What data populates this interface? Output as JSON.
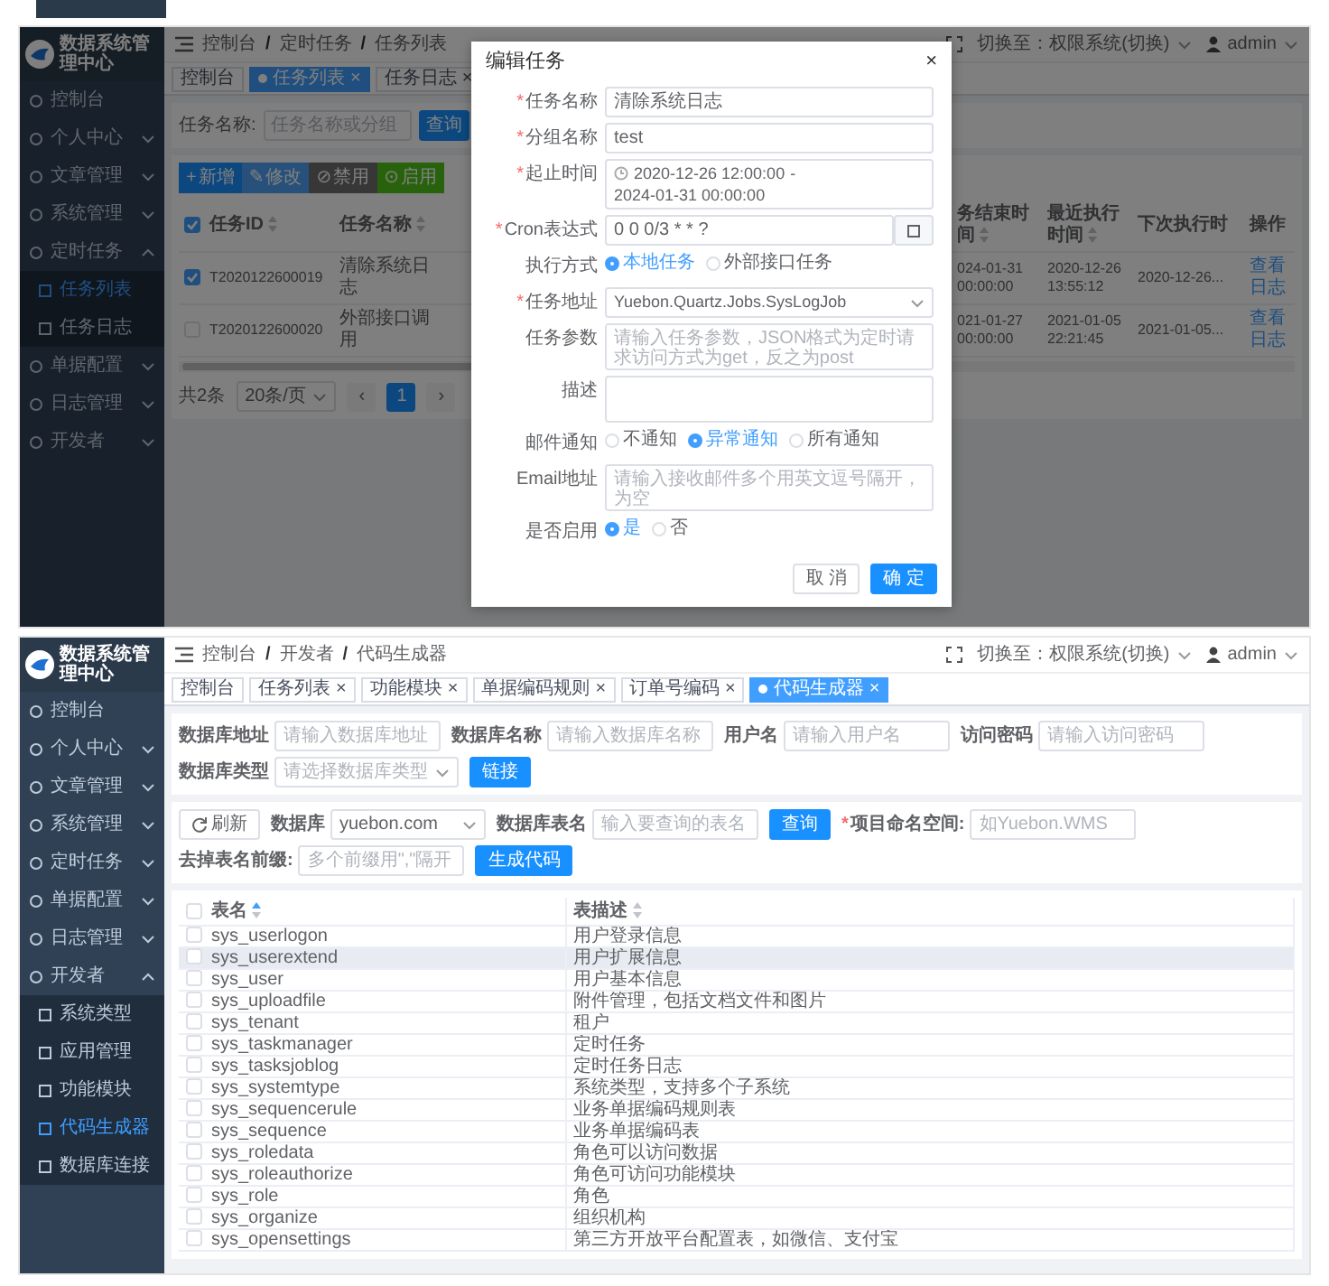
{
  "task_screen": {
    "sidebar": {
      "title": "数据系统管理中心",
      "items": [
        {
          "label": "控制台"
        },
        {
          "label": "个人中心",
          "expanded": false
        },
        {
          "label": "文章管理",
          "expanded": false
        },
        {
          "label": "系统管理",
          "expanded": false
        },
        {
          "label": "定时任务",
          "expanded": true,
          "children": [
            {
              "label": "任务列表",
              "selected": true
            },
            {
              "label": "任务日志",
              "selected": false
            }
          ]
        },
        {
          "label": "单据配置",
          "expanded": false
        },
        {
          "label": "日志管理",
          "expanded": false
        },
        {
          "label": "开发者",
          "expanded": false
        }
      ]
    },
    "breadcrumb": {
      "separator": "/",
      "items": [
        "控制台",
        "定时任务",
        "任务列表"
      ]
    },
    "system_switch": "切换至：权限系统(切换)",
    "user": "admin",
    "tabs": [
      {
        "label": "控制台",
        "selected": false
      },
      {
        "label": "任务列表",
        "close": "×",
        "selected": true
      },
      {
        "label": "任务日志",
        "close": "×",
        "selected": false
      }
    ],
    "search": {
      "label": "任务名称:",
      "placeholder": "任务名称或分组",
      "button": "查询"
    },
    "toolbar": [
      {
        "icon": "+",
        "label": "新增",
        "kind": "primary"
      },
      {
        "icon": "✎",
        "label": "修改",
        "kind": "light"
      },
      {
        "icon": "⊘",
        "label": "禁用",
        "kind": "dark"
      },
      {
        "icon": "⊙",
        "label": "启用",
        "kind": "success"
      }
    ],
    "table": {
      "header_checked": true,
      "columns": [
        {
          "label": "任务ID",
          "kind": "code",
          "sortable": true,
          "ascending": false
        },
        {
          "label": "任务名称",
          "kind": "text",
          "sortable": true,
          "ascending": false
        },
        {
          "label": "务结束时间",
          "kind": "time",
          "sortable": true,
          "ascending": false
        },
        {
          "label": "最近执行时间",
          "kind": "time",
          "sortable": true,
          "ascending": false
        },
        {
          "label": "下次执行时",
          "kind": "time"
        },
        {
          "label": "操作",
          "kind": "action"
        }
      ],
      "rows": [
        {
          "checked": true,
          "cells": [
            "T2020122600019",
            "清除系统日志",
            "024-01-31 00:00:00",
            "2020-12-26 13:55:12",
            "2020-12-26...",
            "查看日志"
          ]
        },
        {
          "checked": false,
          "cells": [
            "T2020122600020",
            "外部接口调用",
            "021-01-27 00:00:00",
            "2021-01-05 22:21:45",
            "2021-01-05...",
            "查看日志"
          ]
        }
      ]
    },
    "pagination": {
      "total": "共2条",
      "page_size": "20条/页",
      "prev": "‹",
      "next": "›",
      "pages": [
        {
          "label": "1",
          "selected": true
        }
      ]
    },
    "modal": {
      "title": "编辑任务",
      "close": "×",
      "required_mark": "*",
      "fields": [
        {
          "kind": "text",
          "label": "任务名称",
          "required": true,
          "value": "清除系统日志"
        },
        {
          "kind": "text",
          "label": "分组名称",
          "required": true,
          "value": "test"
        },
        {
          "kind": "daterange",
          "label": "起止时间",
          "required": true,
          "start": "2020-12-26 12:00:00",
          "separator": "-",
          "end": "2024-01-31 00:00:00"
        },
        {
          "kind": "cron",
          "label": "Cron表达式",
          "required": true,
          "value": "0 0 0/3 * * ?"
        },
        {
          "kind": "radio",
          "label": "执行方式",
          "required": false,
          "options": [
            {
              "label": "本地任务",
              "selected": true
            },
            {
              "label": "外部接口任务",
              "selected": false
            }
          ]
        },
        {
          "kind": "select",
          "label": "任务地址",
          "required": true,
          "value": "Yuebon.Quartz.Jobs.SysLogJob"
        },
        {
          "kind": "textarea",
          "label": "任务参数",
          "required": false,
          "placeholder": "请输入任务参数，JSON格式为定时请求访问方式为get，反之为post"
        },
        {
          "kind": "textarea",
          "label": "描述",
          "required": false
        },
        {
          "kind": "radio",
          "label": "邮件通知",
          "required": false,
          "options": [
            {
              "label": "不通知",
              "selected": false
            },
            {
              "label": "异常通知",
              "selected": true
            },
            {
              "label": "所有通知",
              "selected": false
            }
          ]
        },
        {
          "kind": "textarea",
          "label": "Email地址",
          "required": false,
          "placeholder": "请输入接收邮件多个用英文逗号隔开，为空"
        },
        {
          "kind": "radio",
          "label": "是否启用",
          "required": false,
          "options": [
            {
              "label": "是",
              "selected": true
            },
            {
              "label": "否",
              "selected": false
            }
          ]
        }
      ],
      "buttons": [
        {
          "label": "取 消",
          "primary": false
        },
        {
          "label": "确 定",
          "primary": true
        }
      ]
    }
  },
  "codegen_screen": {
    "sidebar": {
      "title": "数据系统管理中心",
      "items": [
        {
          "label": "控制台"
        },
        {
          "label": "个人中心",
          "expanded": false
        },
        {
          "label": "文章管理",
          "expanded": false
        },
        {
          "label": "系统管理",
          "expanded": false
        },
        {
          "label": "定时任务",
          "expanded": false
        },
        {
          "label": "单据配置",
          "expanded": false
        },
        {
          "label": "日志管理",
          "expanded": false
        },
        {
          "label": "开发者",
          "expanded": true,
          "children": [
            {
              "label": "系统类型",
              "selected": false
            },
            {
              "label": "应用管理",
              "selected": false
            },
            {
              "label": "功能模块",
              "selected": false
            },
            {
              "label": "代码生成器",
              "selected": true
            },
            {
              "label": "数据库连接",
              "selected": false
            }
          ]
        }
      ]
    },
    "breadcrumb": {
      "separator": "/",
      "items": [
        "控制台",
        "开发者",
        "代码生成器"
      ]
    },
    "system_switch": "切换至：权限系统(切换)",
    "user": "admin",
    "tabs": [
      {
        "label": "控制台",
        "selected": false
      },
      {
        "label": "任务列表",
        "close": "×",
        "selected": false
      },
      {
        "label": "功能模块",
        "close": "×",
        "selected": false
      },
      {
        "label": "单据编码规则",
        "close": "×",
        "selected": false
      },
      {
        "label": "订单号编码",
        "close": "×",
        "selected": false
      },
      {
        "label": "代码生成器",
        "close": "×",
        "selected": true
      }
    ],
    "required_mark": "*",
    "connection_form": [
      {
        "kind": "input",
        "label": "数据库地址",
        "placeholder": "请输入数据库地址"
      },
      {
        "kind": "input",
        "label": "数据库名称",
        "placeholder": "请输入数据库名称"
      },
      {
        "kind": "input",
        "label": "用户名",
        "placeholder": "请输入用户名"
      },
      {
        "kind": "input",
        "label": "访问密码",
        "placeholder": "请输入访问密码"
      },
      {
        "kind": "select",
        "label": "数据库类型",
        "placeholder": "请选择数据库类型"
      },
      {
        "kind": "button",
        "label": "链接",
        "primary": true
      }
    ],
    "table_form": [
      {
        "kind": "button",
        "label": "刷新",
        "primary": false,
        "with_icon": true
      },
      {
        "kind": "select",
        "label": "数据库",
        "value": "yuebon.com"
      },
      {
        "kind": "input",
        "label": "数据库表名",
        "placeholder": "输入要查询的表名"
      },
      {
        "kind": "button",
        "label": "查询",
        "primary": true
      },
      {
        "kind": "input",
        "label": "项目命名空间:",
        "required": true,
        "placeholder": "如Yuebon.WMS"
      },
      {
        "kind": "input",
        "label": "去掉表名前缀:",
        "placeholder": "多个前缀用\",\"隔开"
      },
      {
        "kind": "button",
        "label": "生成代码",
        "primary": true
      }
    ],
    "table": {
      "header_checked": false,
      "columns": [
        {
          "label": "表名",
          "sortable": true,
          "ascending": true
        },
        {
          "label": "表描述",
          "sortable": true,
          "ascending": false
        }
      ],
      "rows": [
        {
          "checked": false,
          "highlighted": false,
          "cells": [
            "sys_userlogon",
            "用户登录信息"
          ]
        },
        {
          "checked": false,
          "highlighted": true,
          "cells": [
            "sys_userextend",
            "用户扩展信息"
          ]
        },
        {
          "checked": false,
          "highlighted": false,
          "cells": [
            "sys_user",
            "用户基本信息"
          ]
        },
        {
          "checked": false,
          "highlighted": false,
          "cells": [
            "sys_uploadfile",
            "附件管理，包括文档文件和图片"
          ]
        },
        {
          "checked": false,
          "highlighted": false,
          "cells": [
            "sys_tenant",
            "租户"
          ]
        },
        {
          "checked": false,
          "highlighted": false,
          "cells": [
            "sys_taskmanager",
            "定时任务"
          ]
        },
        {
          "checked": false,
          "highlighted": false,
          "cells": [
            "sys_tasksjoblog",
            "定时任务日志"
          ]
        },
        {
          "checked": false,
          "highlighted": false,
          "cells": [
            "sys_systemtype",
            "系统类型，支持多个子系统"
          ]
        },
        {
          "checked": false,
          "highlighted": false,
          "cells": [
            "sys_sequencerule",
            "业务单据编码规则表"
          ]
        },
        {
          "checked": false,
          "highlighted": false,
          "cells": [
            "sys_sequence",
            "业务单据编码表"
          ]
        },
        {
          "checked": false,
          "highlighted": false,
          "cells": [
            "sys_roledata",
            "角色可以访问数据"
          ]
        },
        {
          "checked": false,
          "highlighted": false,
          "cells": [
            "sys_roleauthorize",
            "角色可访问功能模块"
          ]
        },
        {
          "checked": false,
          "highlighted": false,
          "cells": [
            "sys_role",
            "角色"
          ]
        },
        {
          "checked": false,
          "highlighted": false,
          "cells": [
            "sys_organize",
            "组织机构"
          ]
        },
        {
          "checked": false,
          "highlighted": false,
          "cells": [
            "sys_opensettings",
            "第三方开放平台配置表，如微信、支付宝"
          ]
        }
      ]
    }
  }
}
